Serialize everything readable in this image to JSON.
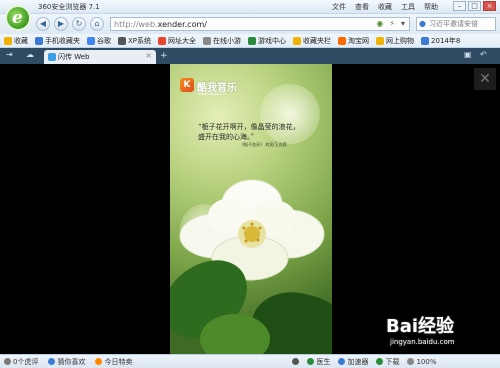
{
  "window": {
    "title": "360安全浏览器 7.1",
    "menu": [
      "文件",
      "查看",
      "收藏",
      "工具",
      "帮助"
    ]
  },
  "navbar": {
    "url_prefix": "http://web.",
    "url_domain": "xender.com/",
    "search_placeholder": "习近平邀请安倍"
  },
  "bookmarks": [
    {
      "label": "收藏",
      "color": "#f0b400"
    },
    {
      "label": "手机收藏夹",
      "color": "#3b7bd4"
    },
    {
      "label": "谷歌",
      "color": "#4285f4"
    },
    {
      "label": "XP系统",
      "color": "#555555"
    },
    {
      "label": "网址大全",
      "color": "#e4472b"
    },
    {
      "label": "在线小游",
      "color": "#888888"
    },
    {
      "label": "游戏中心",
      "color": "#2a8c3a"
    },
    {
      "label": "收藏夹栏",
      "color": "#f0b400"
    },
    {
      "label": "淘宝网",
      "color": "#ff6a00"
    },
    {
      "label": "网上购物",
      "color": "#f0b400"
    },
    {
      "label": "2014年8",
      "color": "#3b7bd4"
    }
  ],
  "tab": {
    "label": "闪传 Web"
  },
  "page": {
    "app_name": "酷我音乐",
    "app_url": "www.kuwo.cn",
    "quote_line1": "“栀子花开啊开，像晶莹的浪花，",
    "quote_line2": "盛开在我的心海。”",
    "quote_source": "《栀子花开》 何炅/王志毅"
  },
  "statusbar": {
    "items": [
      "0个虎评",
      "猜你喜欢",
      "今日特卖"
    ],
    "right_items": [
      "医生",
      "加速器",
      "下载",
      "100%"
    ]
  },
  "watermark": {
    "main": "Bai经验",
    "sub": "jingyan.baidu.com"
  },
  "colors": {
    "accent": "#3b7bd4",
    "tabbar": "#2f4a63"
  }
}
